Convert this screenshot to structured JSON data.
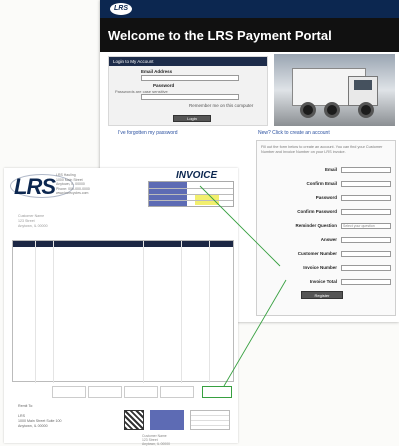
{
  "portal": {
    "logo_text": "LRS",
    "welcome_title": "Welcome to the LRS Payment Portal",
    "login_panel_title": "Login to My Account",
    "email_label": "Email Address",
    "password_label": "Password",
    "password_hint": "Passwords are case sensitive",
    "remember_label": "Remember me on this computer",
    "login_button": "Login",
    "forgot_link": "I've forgotten my password",
    "register_link": "New? Click to create an account",
    "register_note": "Fill out the form below to create an account. You can find your Customer Number and Invoice Number on your LRS invoice.",
    "register_fields": [
      "Email",
      "Confirm Email",
      "Password",
      "Confirm Password",
      "Reminder Question",
      "Answer",
      "Customer Number",
      "Invoice Number",
      "Invoice Total"
    ],
    "reminder_placeholder": "Select your question",
    "register_button": "Register"
  },
  "invoice": {
    "logo_text": "LRS",
    "address_block": "LRS Hauling\n1000 Main Street\nAnytown, IL 00000\nPhone: 000-000-0000\nwww.lrsrecycles.com",
    "title": "INVOICE",
    "bill_to": "Customer Name\n123 Street\nAnytown, IL 00000",
    "remit_to": "Remit To:\n\nLRS\n1000 Main Street Suite 100\nAnytown, IL 00000",
    "remit_address": "Customer Name\n123 Street\nAnytown, IL 00000"
  },
  "colors": {
    "navy": "#0c2750",
    "invoice_blue": "#5d6bb4",
    "highlight_yellow": "#f2ef6e",
    "connector_green": "#37a040"
  }
}
